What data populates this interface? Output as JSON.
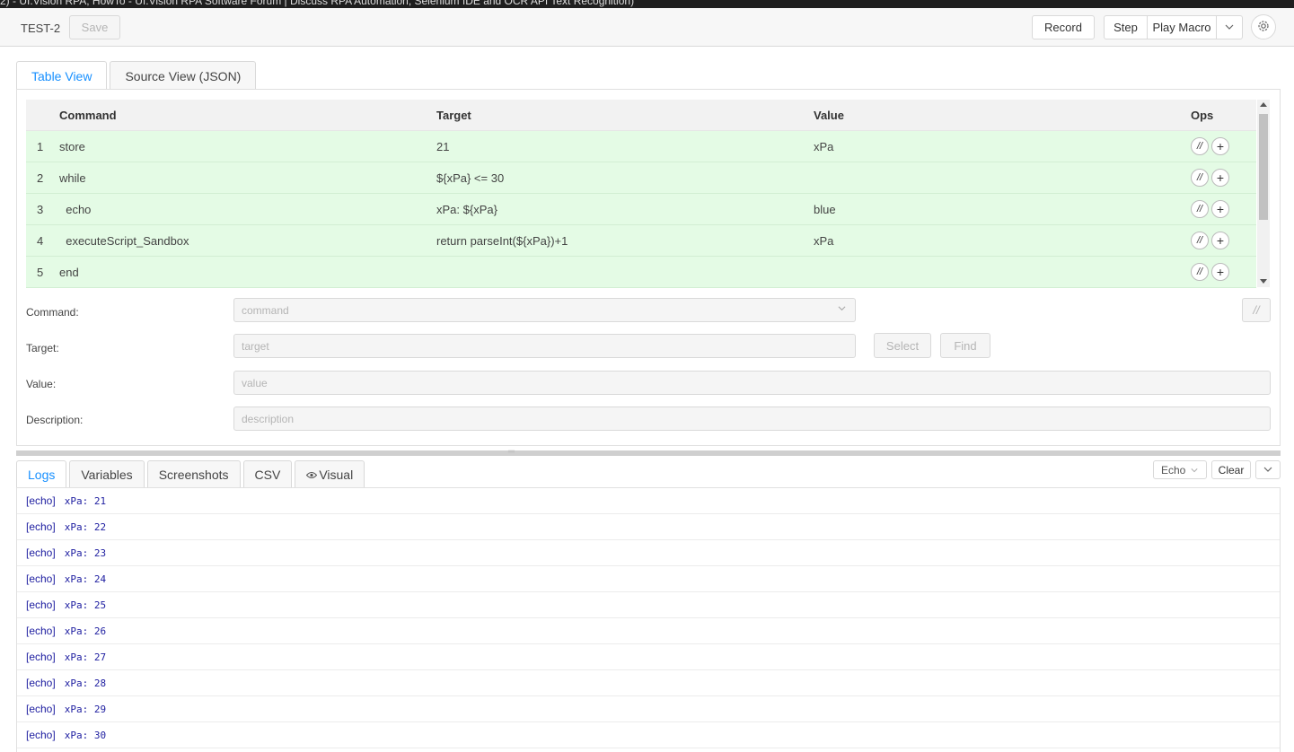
{
  "window_title": "2) - UI.Vision RPA, HowTo - UI.Vision RPA Software Forum | Discuss RPA Automation, Selenium IDE and OCR API Text Recognition)",
  "toolbar": {
    "macro_name": "TEST-2",
    "save_label": "Save",
    "record_label": "Record",
    "step_label": "Step",
    "play_label": "Play Macro",
    "play_dropdown_icon": "chevron-down-icon",
    "settings_icon": "gear-icon"
  },
  "editor_tabs": [
    {
      "label": "Table View",
      "active": true
    },
    {
      "label": "Source View (JSON)",
      "active": false
    }
  ],
  "table": {
    "headers": {
      "command": "Command",
      "target": "Target",
      "value": "Value",
      "ops": "Ops"
    },
    "rows": [
      {
        "num": "1",
        "command": "store",
        "target": "21",
        "value": "xPa"
      },
      {
        "num": "2",
        "command": "while",
        "target": "${xPa} <= 30",
        "value": ""
      },
      {
        "num": "3",
        "command": "  echo",
        "target": "xPa: ${xPa}",
        "value": "blue"
      },
      {
        "num": "4",
        "command": "  executeScript_Sandbox",
        "target": "return parseInt(${xPa})+1",
        "value": "xPa"
      },
      {
        "num": "5",
        "command": "end",
        "target": "",
        "value": ""
      }
    ],
    "comment_op": "//",
    "add_op": "+"
  },
  "form": {
    "command_label": "Command",
    "command_placeholder": "command",
    "target_label": "Target",
    "target_placeholder": "target",
    "value_label": "Value",
    "value_placeholder": "value",
    "description_label": "Description",
    "description_placeholder": "description",
    "select_label": "Select",
    "find_label": "Find",
    "comment_label": "//"
  },
  "log_tabs": [
    {
      "label": "Logs",
      "active": true
    },
    {
      "label": "Variables",
      "active": false
    },
    {
      "label": "Screenshots",
      "active": false
    },
    {
      "label": "CSV",
      "active": false
    },
    {
      "label": "Visual",
      "active": false,
      "icon": "eye-icon"
    }
  ],
  "log_controls": {
    "filter_value": "Echo",
    "clear_label": "Clear"
  },
  "logs": [
    {
      "tag": "[echo]",
      "text": "xPa: 21"
    },
    {
      "tag": "[echo]",
      "text": "xPa: 22"
    },
    {
      "tag": "[echo]",
      "text": "xPa: 23"
    },
    {
      "tag": "[echo]",
      "text": "xPa: 24"
    },
    {
      "tag": "[echo]",
      "text": "xPa: 25"
    },
    {
      "tag": "[echo]",
      "text": "xPa: 26"
    },
    {
      "tag": "[echo]",
      "text": "xPa: 27"
    },
    {
      "tag": "[echo]",
      "text": "xPa: 28"
    },
    {
      "tag": "[echo]",
      "text": "xPa: 29"
    },
    {
      "tag": "[echo]",
      "text": "xPa: 30"
    }
  ],
  "colors": {
    "accent": "#1890ff",
    "row_green": "#e4fbe5",
    "log_text": "#1d1da0"
  }
}
